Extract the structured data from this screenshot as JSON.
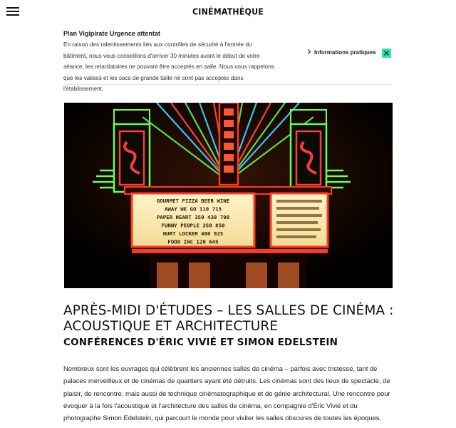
{
  "header": {
    "logo": "CINÉMATHÈQUE",
    "menu_icon": "hamburger-icon"
  },
  "alert": {
    "title": "Plan Vigipirate Urgence attentat",
    "text": "En raison des ralentissements liés aux contrôles de sécurité à l'entrée du bâtiment, nous vous conseillons d'arriver 30 minutes avant le début de votre séance, les retardataires ne pouvant être acceptés en salle. Nous vous rappelons que les valises et les sacs de grande taille ne sont pas acceptés dans l'établissement.",
    "link_label": "Informations pratiques",
    "link_icon": "chevron-right-icon",
    "close_icon": "close-icon",
    "close_color": "#33e0b0"
  },
  "hero": {
    "marquee_left": [
      "GOURMET PIZZA  BEER  WINE",
      "AWAY WE GO   110  715",
      "PAPER HEART  350 430  700",
      "FUNNY PEOPLE   350  850",
      "HURT LOCKER    400  925",
      "FOOD INC   120  645"
    ],
    "marquee_right": [
      "",
      "",
      "",
      "",
      ""
    ]
  },
  "article": {
    "title": "APRÈS-MIDI D'ÉTUDES – LES SALLES DE CINÉMA : ACOUSTIQUE ET ARCHITECTURE",
    "subtitle": "CONFÉRENCES D'ÉRIC VIVIÉ ET SIMON EDELSTEIN",
    "body": "Nombreux sont les ouvrages qui célèbrent les anciennes salles de cinéma – parfois avec tristesse, tant de palaces merveilleux et de cinémas de quartiers ayant été détruits. Les cinémas sont des lieux de spectacle, de plaisir, de rencontre, mais aussi de technique cinématographique et de génie architectural. Une rencontre pour évoquer à la fois l'acoustique et l'architecture des salles de cinéma, en compagnie d'Éric Vivié et du photographe Simon Edelstein, qui parcourt le monde pour visiter les salles obscures de toutes les époques."
  }
}
